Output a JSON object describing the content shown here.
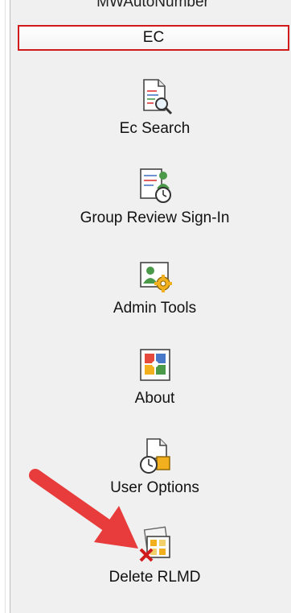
{
  "sidebar": {
    "top_item_label": "MWAutoNumber",
    "active_tab_label": "EC",
    "items": [
      {
        "label": "Ec Search",
        "icon": "document-search-icon"
      },
      {
        "label": "Group Review Sign-In",
        "icon": "group-review-clock-icon"
      },
      {
        "label": "Admin Tools",
        "icon": "admin-gear-icon"
      },
      {
        "label": "About",
        "icon": "about-app-icon"
      },
      {
        "label": "User Options",
        "icon": "user-options-icon"
      },
      {
        "label": "Delete RLMD",
        "icon": "delete-rlmd-icon"
      }
    ]
  },
  "annotation": {
    "icon": "red-arrow-icon",
    "color": "#e83b3b"
  },
  "colors": {
    "active_border": "#d11a1a",
    "panel_bg": "#f0f0f0"
  }
}
